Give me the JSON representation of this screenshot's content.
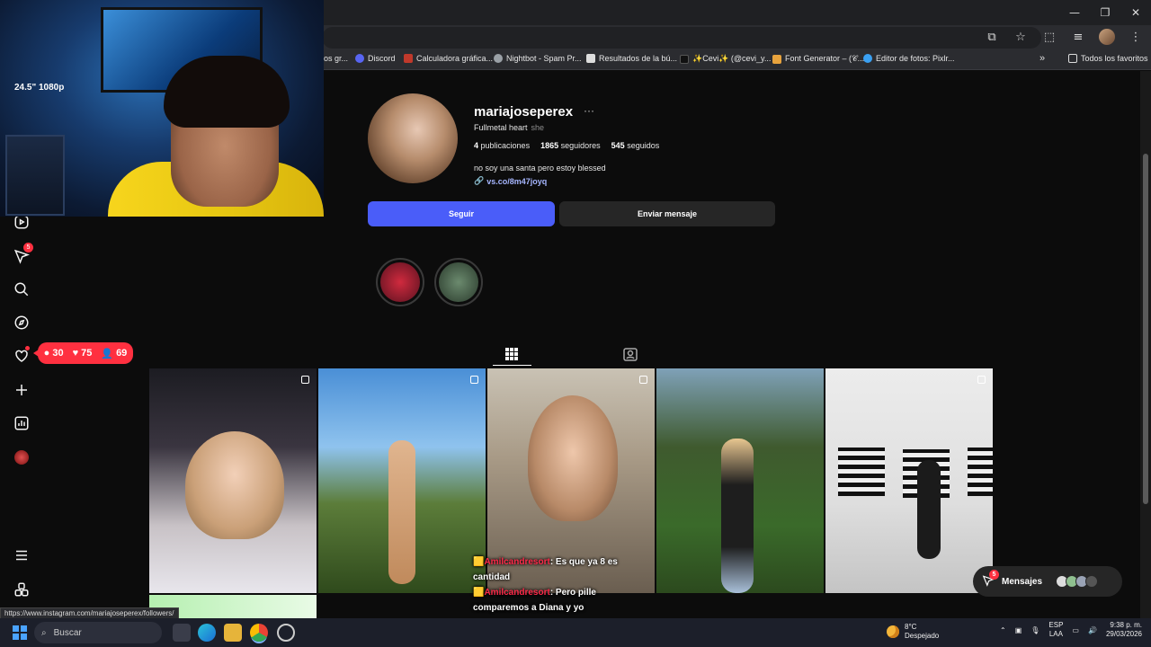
{
  "window": {
    "minimize": "—",
    "restore": "❐",
    "close": "✕"
  },
  "bookmarks": [
    {
      "label": "os gr...",
      "color": "#888888"
    },
    {
      "label": "Discord",
      "color": "#5865f2"
    },
    {
      "label": "Calculadora gráfica...",
      "color": "#c0392b"
    },
    {
      "label": "Nightbot - Spam Pr...",
      "color": "#9aa0a6"
    },
    {
      "label": "Resultados de la bú...",
      "color": "#dddddd"
    },
    {
      "label": "✨Cevi✨ (@cevi_y...",
      "color": "#000000"
    },
    {
      "label": "Font Generator – (𝒞...",
      "color": "#e8a33d"
    },
    {
      "label": "Editor de fotos: Pixlr...",
      "color": "#3aa0f2"
    }
  ],
  "bookmarks_more": "»",
  "all_favorites": "Todos los favoritos",
  "nav": {
    "reels_badge": "",
    "messages_badge": "5"
  },
  "notif_pill": {
    "comments": "30",
    "likes": "75",
    "follows": "69"
  },
  "profile": {
    "username": "mariajoseperex",
    "more": "···",
    "full_name": "Fullmetal heart",
    "pronouns": "she",
    "posts_count": "4",
    "posts_label": "publicaciones",
    "followers_count": "1865",
    "followers_label": "seguidores",
    "following_count": "545",
    "following_label": "seguidos",
    "bio": "no soy una santa pero estoy blessed",
    "link": "vs.co/8m47joyq",
    "follow_button": "Seguir",
    "message_button": "Enviar mensaje"
  },
  "chat": [
    {
      "user": "Amilcandresort",
      "text": ": Es que ya 8 es cantidad"
    },
    {
      "user": "Amilcandresort",
      "text": ": Pero pille comparemos a Diana y yo"
    }
  ],
  "messages_pill": {
    "label": "Mensajes",
    "badge": "5"
  },
  "status_url": "https://www.instagram.com/mariajoseperex/followers/",
  "taskbar": {
    "search_placeholder": "Buscar",
    "weather_temp": "8°C",
    "weather_desc": "Despejado",
    "lang_top": "ESP",
    "lang_bottom": "LAA",
    "time": "9:38 p. m.",
    "date": "29/03/2026"
  },
  "webcam": {
    "caption": "24.5\" 1080p"
  },
  "colors": {
    "follow_button": "#4a5df9",
    "badge_red": "#ff3040",
    "link": "#a6b6ff"
  }
}
